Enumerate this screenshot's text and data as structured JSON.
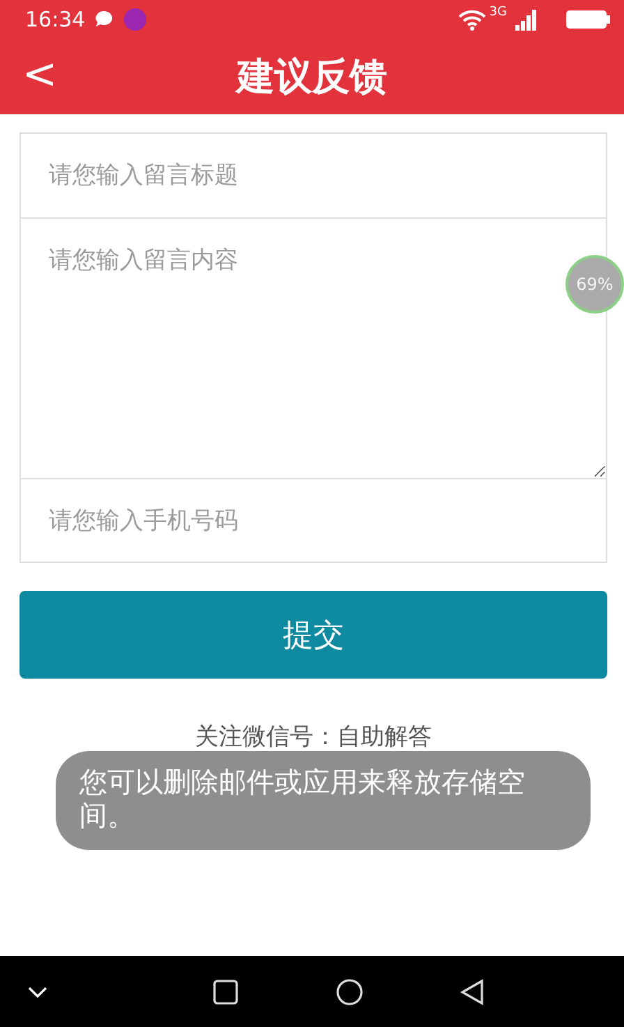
{
  "status_bar": {
    "time": "16:34",
    "network": "3G"
  },
  "header": {
    "back": "<",
    "title": "建议反馈"
  },
  "form": {
    "title_field": {
      "placeholder": "请您输入留言标题"
    },
    "content_field": {
      "placeholder": "请您输入留言内容"
    },
    "phone_field": {
      "placeholder": "请您输入手机号码"
    },
    "submit": "提交"
  },
  "footer_note": "关注微信号：自助解答",
  "float_ball": "69%",
  "toast": "您可以删除邮件或应用来释放存储空间。"
}
